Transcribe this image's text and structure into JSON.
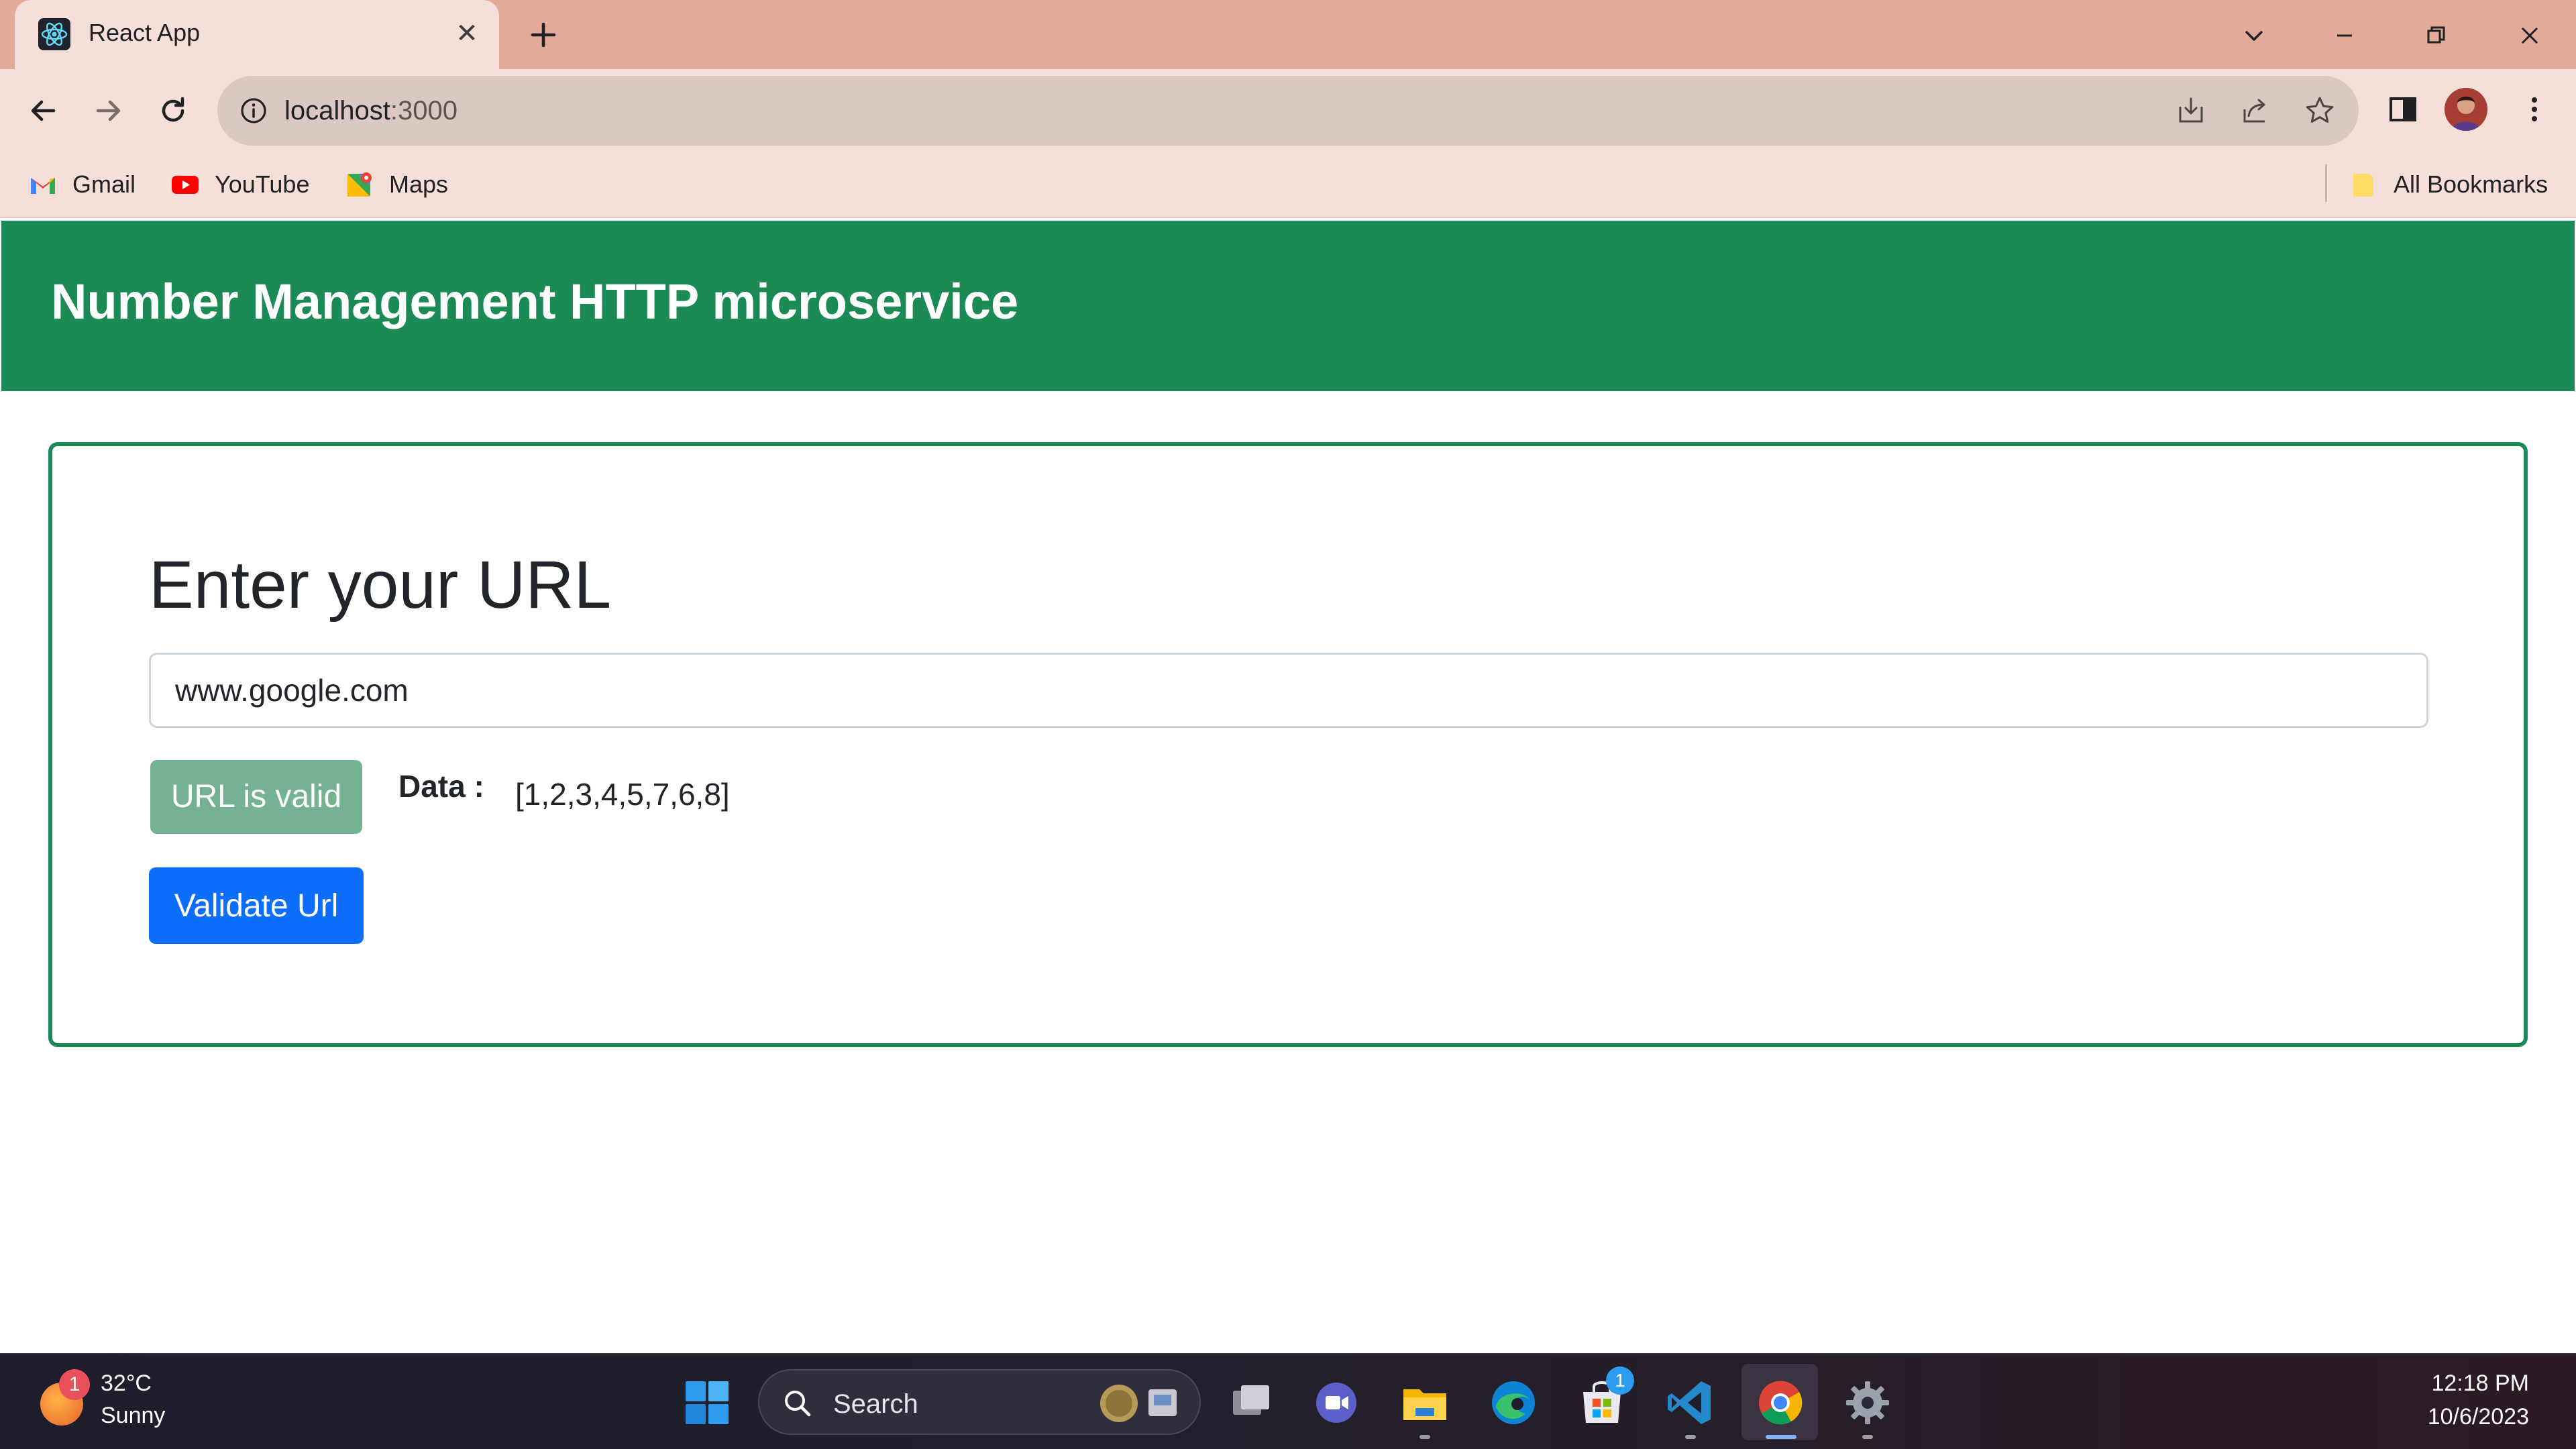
{
  "browser": {
    "tab": {
      "title": "React App",
      "favicon": "react-icon",
      "close_label": "✕"
    },
    "new_tab_icon": "plus-icon",
    "window_controls": [
      "chevron-down-icon",
      "minimize-icon",
      "restore-icon",
      "close-icon"
    ],
    "address": {
      "host": "localhost",
      "port": ":3000"
    },
    "bookmarks": [
      {
        "label": "Gmail",
        "icon": "gmail-icon"
      },
      {
        "label": "YouTube",
        "icon": "youtube-icon"
      },
      {
        "label": "Maps",
        "icon": "maps-icon"
      }
    ],
    "all_bookmarks_label": "All Bookmarks"
  },
  "app": {
    "header_title": "Number Management HTTP microservice",
    "heading": "Enter your URL",
    "url_value": "www.google.com",
    "status_label": "URL is valid",
    "data_label": "Data :",
    "data_value": "[1,2,3,4,5,7,6,8]",
    "validate_button_label": "Validate Url",
    "colors": {
      "header": "#1b8a55",
      "primary_button": "#0d6efd",
      "valid_badge": "#74b293"
    }
  },
  "taskbar": {
    "weather": {
      "temp": "32°C",
      "condition": "Sunny",
      "badge": "1"
    },
    "search_placeholder": "Search",
    "store_badge": "1",
    "clock": {
      "time": "12:18 PM",
      "date": "10/6/2023"
    }
  }
}
